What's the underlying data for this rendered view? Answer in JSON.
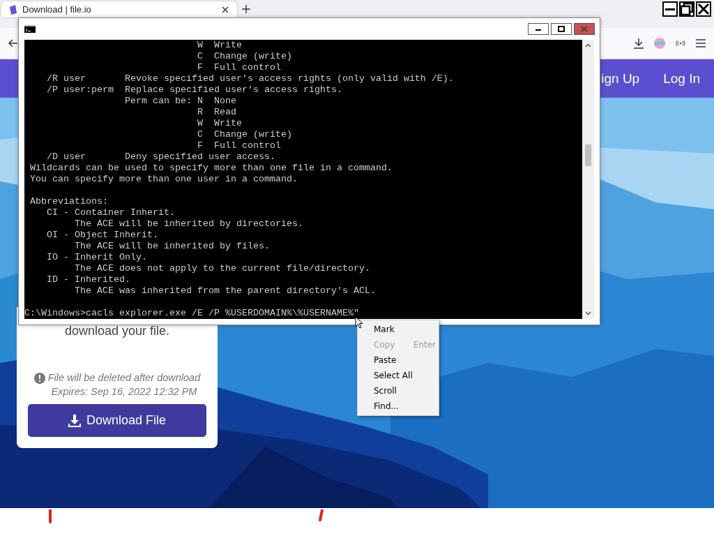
{
  "browser": {
    "tabs": [
      {
        "title": "Download | file.io",
        "selected": true
      }
    ]
  },
  "nav": {
    "links": [
      "ign Up",
      "Log In"
    ]
  },
  "card": {
    "message": "download your file.",
    "notice": "File will be deleted after download",
    "expires": "Expires: Sep 16, 2022 12:32 PM",
    "button": "Download File"
  },
  "console": {
    "lines": [
      {
        "kind": "text",
        "text": "                              W  Write"
      },
      {
        "kind": "text",
        "text": "                              C  Change (write)"
      },
      {
        "kind": "text",
        "text": "                              F  Full control"
      },
      {
        "kind": "text",
        "text": "   /R user       Revoke specified user's access rights (only valid with /E)."
      },
      {
        "kind": "text",
        "text": "   /P user:perm  Replace specified user's access rights."
      },
      {
        "kind": "text",
        "text": "                 Perm can be: N  None"
      },
      {
        "kind": "text",
        "text": "                              R  Read"
      },
      {
        "kind": "text",
        "text": "                              W  Write"
      },
      {
        "kind": "text",
        "text": "                              C  Change (write)"
      },
      {
        "kind": "text",
        "text": "                              F  Full control"
      },
      {
        "kind": "text",
        "text": "   /D user       Deny specified user access."
      },
      {
        "kind": "text",
        "text": "Wildcards can be used to specify more than one file in a command."
      },
      {
        "kind": "text",
        "text": "You can specify more than one user in a command."
      },
      {
        "kind": "blank"
      },
      {
        "kind": "text",
        "text": "Abbreviations:"
      },
      {
        "kind": "text",
        "text": "   CI - Container Inherit."
      },
      {
        "kind": "text",
        "text": "        The ACE will be inherited by directories."
      },
      {
        "kind": "text",
        "text": "   OI - Object Inherit."
      },
      {
        "kind": "text",
        "text": "        The ACE will be inherited by files."
      },
      {
        "kind": "text",
        "text": "   IO - Inherit Only."
      },
      {
        "kind": "text",
        "text": "        The ACE does not apply to the current file/directory."
      },
      {
        "kind": "text",
        "text": "   ID - Inherited."
      },
      {
        "kind": "text",
        "text": "        The ACE was inherited from the parent directory's ACL."
      },
      {
        "kind": "blank"
      },
      {
        "kind": "prompt",
        "text": "C:\\Windows>cacls explorer.exe /E /P %USERDOMAIN%\\%USERNAME%\""
      }
    ]
  },
  "context_menu": {
    "items": [
      {
        "label": "Mark",
        "disabled": false
      },
      {
        "label": "Copy",
        "shortcut": "Enter",
        "disabled": true
      },
      {
        "label": "Paste",
        "disabled": false
      },
      {
        "label": "Select All",
        "disabled": false
      },
      {
        "label": "Scroll",
        "disabled": false
      },
      {
        "label": "Find...",
        "disabled": false
      }
    ]
  }
}
